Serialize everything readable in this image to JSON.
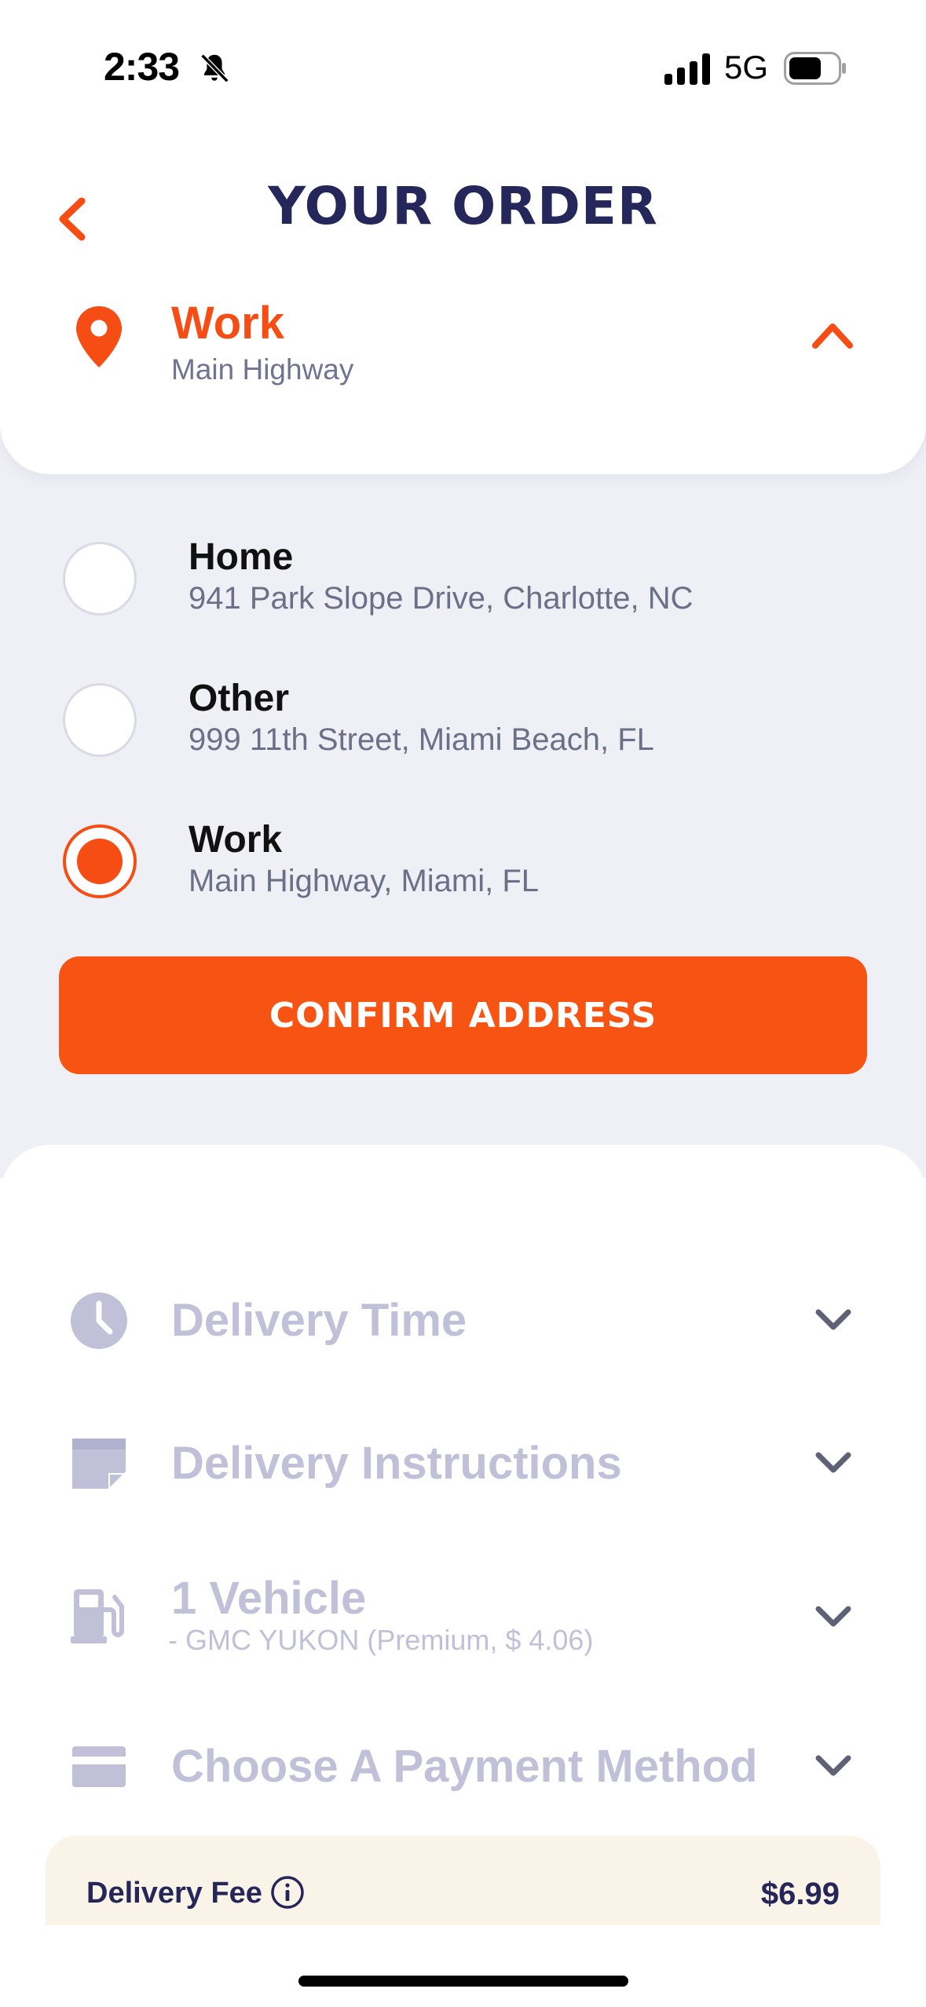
{
  "status_bar": {
    "time": "2:33",
    "network": "5G",
    "icons": [
      "bell-off-icon",
      "cellular-signal-icon",
      "battery-icon"
    ]
  },
  "header": {
    "title": "YOUR ORDER",
    "back_icon": "chevron-left-icon"
  },
  "selected_address": {
    "name": "Work",
    "street": "Main Highway",
    "icon": "location-pin-icon",
    "toggle_icon": "chevron-up-icon"
  },
  "address_options": [
    {
      "name": "Home",
      "street": "941 Park Slope Drive, Charlotte, NC",
      "selected": false
    },
    {
      "name": "Other",
      "street": "999 11th Street, Miami Beach, FL",
      "selected": false
    },
    {
      "name": "Work",
      "street": "Main Highway, Miami, FL",
      "selected": true
    }
  ],
  "confirm_button": {
    "label": "CONFIRM ADDRESS"
  },
  "sections": [
    {
      "label": "Delivery Time",
      "icon": "clock-icon"
    },
    {
      "label": "Delivery Instructions",
      "icon": "note-icon"
    },
    {
      "label": "1 Vehicle",
      "sublabel": "- GMC YUKON (Premium, $ 4.06)",
      "icon": "fuel-pump-icon"
    },
    {
      "label": "Choose A Payment Method",
      "icon": "credit-card-icon"
    }
  ],
  "fees": {
    "delivery_fee_label": "Delivery Fee",
    "delivery_fee_value": "$6.99",
    "info_icon": "info-icon"
  },
  "colors": {
    "accent": "#f54d14",
    "title": "#252659",
    "muted": "#c0c1d8",
    "panel_bg": "#eff0f6",
    "fee_bg": "#faf3e8"
  }
}
